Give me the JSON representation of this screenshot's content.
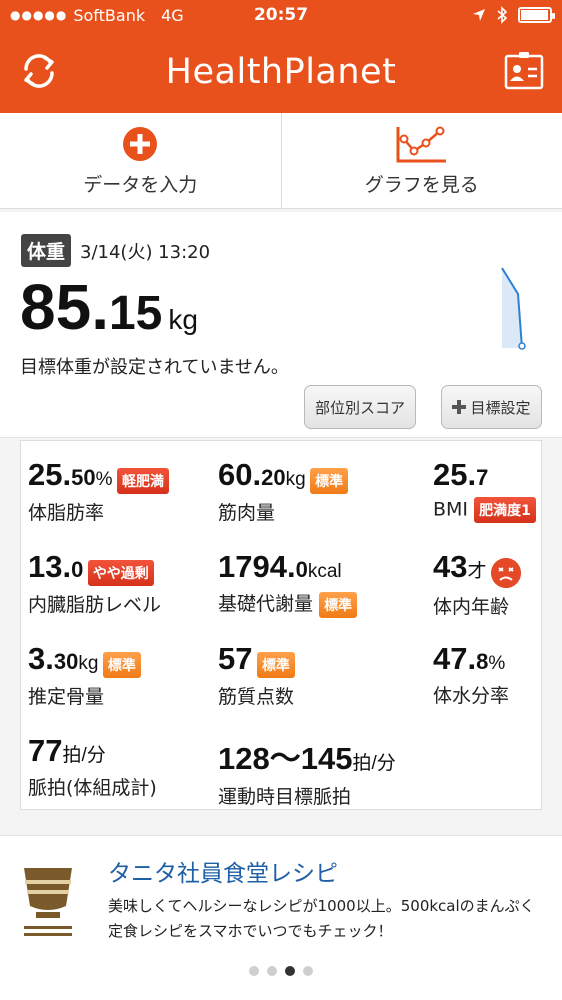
{
  "status_bar": {
    "dots": "●●●●●",
    "carrier": "SoftBank",
    "network": "4G",
    "time": "20:57",
    "battery_level": 0.95
  },
  "header": {
    "title": "HealthPlanet"
  },
  "actions": [
    {
      "label": "データを入力",
      "icon": "plus-circle-icon"
    },
    {
      "label": "グラフを見る",
      "icon": "line-graph-icon"
    }
  ],
  "weight": {
    "tag": "体重",
    "date": "3/14(火) 13:20",
    "value_int": "85.",
    "value_dec": "15",
    "unit": "kg",
    "goal_message": "目標体重が設定されていません。",
    "buttons": {
      "score": "部位別スコア",
      "goal": "目標設定"
    }
  },
  "metrics": {
    "body_fat": {
      "int": "25.",
      "dec": "50",
      "unit": "%",
      "badge": "軽肥満",
      "label": "体脂肪率"
    },
    "muscle": {
      "int": "60.",
      "dec": "20",
      "unit": "kg",
      "badge": "標準",
      "label": "筋肉量"
    },
    "bmi": {
      "int": "25.",
      "dec": "7",
      "badge": "肥満度1",
      "label": "BMI"
    },
    "visceral": {
      "int": "13.",
      "dec": "0",
      "badge": "やや過剰",
      "label": "内臓脂肪レベル"
    },
    "bmr": {
      "int": "1794.",
      "dec": "0",
      "unit": "kcal",
      "badge": "標準",
      "label": "基礎代謝量"
    },
    "body_age": {
      "int": "43",
      "unit": "才",
      "label": "体内年齢"
    },
    "bone": {
      "int": "3.",
      "dec": "30",
      "unit": "kg",
      "badge": "標準",
      "label": "推定骨量"
    },
    "muscle_score": {
      "int": "57",
      "badge": "標準",
      "label": "筋質点数"
    },
    "water": {
      "int": "47.",
      "dec": "8",
      "unit": "%",
      "label": "体水分率"
    },
    "pulse": {
      "int": "77",
      "unit": "拍/分",
      "label": "脈拍(体組成計)"
    },
    "target_pulse": {
      "int": "128〜145",
      "unit": "拍/分",
      "label": "運動時目標脈拍"
    }
  },
  "recipe": {
    "title": "タニタ社員食堂レシピ",
    "description": "美味しくてヘルシーなレシピが1000以上。500kcalのまんぷく定食レシピをスマホでいつでもチェック！",
    "page_current": 3,
    "page_count": 4
  },
  "colors": {
    "brand": "#e8511b",
    "badge_orange": "#f07b16",
    "badge_red": "#d5311b",
    "link": "#1f5fa6"
  }
}
